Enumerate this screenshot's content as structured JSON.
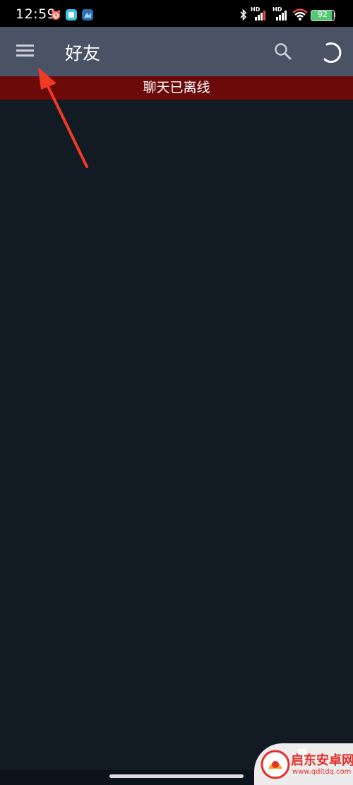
{
  "status_bar": {
    "time": "12:59",
    "battery_level": "92",
    "battery_fraction": 0.92,
    "signal_1_label": "HD",
    "signal_2_label": "HD",
    "icons": [
      "alarm-icon",
      "app-notification-icon",
      "app-notification-icon-2",
      "bluetooth-icon",
      "signal-icon",
      "signal-icon-2",
      "wifi-icon",
      "battery-icon"
    ]
  },
  "app_bar": {
    "title": "好友",
    "menu_icon": "menu-icon",
    "search_icon": "search-icon",
    "loading_icon": "loading-spinner-icon",
    "color": "#4a5366"
  },
  "banner": {
    "text": "聊天已离线",
    "color": "#6c0a0a"
  },
  "overlay": {
    "annotation": "red-arrow-icon",
    "color": "#f03a24"
  },
  "watermark": {
    "name": "启东安卓网",
    "url": "www.qdltdq.com",
    "color": "#e4302a"
  },
  "colors": {
    "background": "#121a24"
  }
}
